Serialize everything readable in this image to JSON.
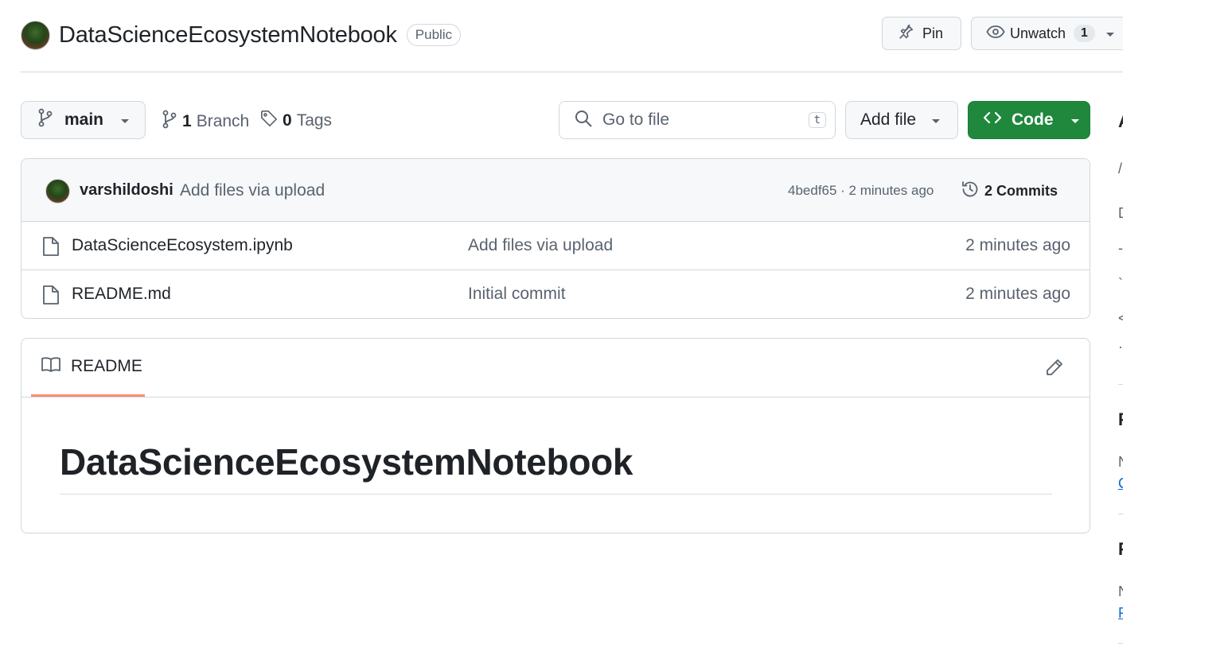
{
  "repo": {
    "name": "DataScienceEcosystemNotebook",
    "visibility": "Public"
  },
  "header": {
    "pin_label": "Pin",
    "watch_label": "Unwatch",
    "watch_count": "1"
  },
  "toolbar": {
    "branch": "main",
    "branches_count": "1",
    "branches_label": "Branch",
    "tags_count": "0",
    "tags_label": "Tags",
    "search_placeholder": "Go to file",
    "search_shortcut": "t",
    "add_file_label": "Add file",
    "code_label": "Code"
  },
  "latest_commit": {
    "author": "varshildoshi",
    "message": "Add files via upload",
    "meta": "4bedf65 · 2 minutes ago",
    "commits_label": "2 Commits"
  },
  "files": [
    {
      "name": "DataScienceEcosystem.ipynb",
      "message": "Add files via upload",
      "age": "2 minutes ago"
    },
    {
      "name": "README.md",
      "message": "Initial commit",
      "age": "2 minutes ago"
    }
  ],
  "readme": {
    "tab_label": "README",
    "heading": "DataScienceEcosystemNotebook"
  },
  "sidebar_fragments": {
    "a": "A",
    "b": "/",
    "c": "D",
    "d": "-",
    "e": "`",
    "f": "<",
    "g": "·",
    "h": "F",
    "i": "N",
    "j": "C",
    "k": "F",
    "l": "N",
    "m": "F"
  },
  "colors": {
    "accent_green": "#1f883d",
    "tab_underline": "#fd8c73",
    "border": "#d0d7de",
    "muted_text": "#59636e",
    "link": "#0969da"
  }
}
